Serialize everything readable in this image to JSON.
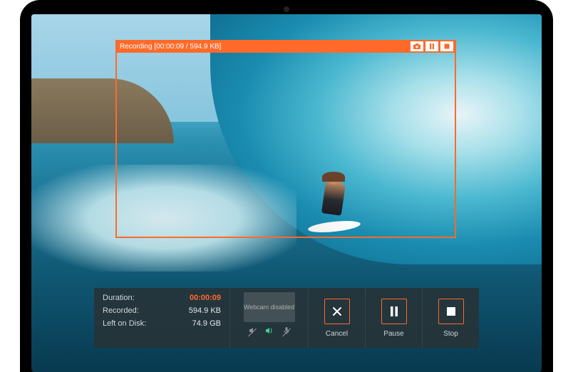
{
  "colors": {
    "accent": "#ff6a2a",
    "panel": "rgba(40,50,55,0.88)"
  },
  "capture": {
    "bar_text": "Recording [00:00:09 / 594.9 KB]",
    "buttons": {
      "screenshot": "camera-icon",
      "pause": "pause-icon",
      "stop": "stop-icon"
    }
  },
  "panel": {
    "stats": {
      "duration_label": "Duration:",
      "duration_value": "00:00:09",
      "recorded_label": "Recorded:",
      "recorded_value": "594.9 KB",
      "left_label": "Left on Disk:",
      "left_value": "74.9 GB"
    },
    "webcam": {
      "status_text": "Webcam disabled",
      "icons": {
        "system_audio": "system-audio-icon",
        "speaker": "speaker-icon",
        "microphone": "microphone-icon"
      }
    },
    "controls": {
      "cancel": "Cancel",
      "pause": "Pause",
      "stop": "Stop"
    }
  }
}
